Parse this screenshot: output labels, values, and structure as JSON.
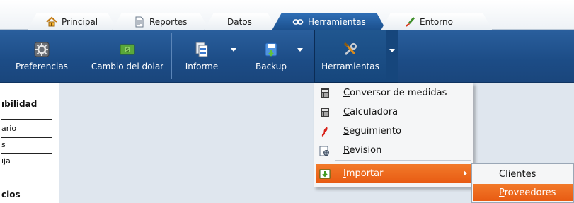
{
  "tabs": [
    {
      "label": "Principal",
      "icon": "home-icon",
      "active": false
    },
    {
      "label": "Reportes",
      "icon": "document-icon",
      "active": false
    },
    {
      "label": "Datos",
      "icon": "",
      "active": false
    },
    {
      "label": "Herramientas",
      "icon": "link-icon",
      "active": true
    },
    {
      "label": "Entorno",
      "icon": "brush-icon",
      "active": false
    }
  ],
  "ribbon": {
    "preferencias": "Preferencias",
    "cambio_dolar": "Cambio del dolar",
    "informe": "Informe",
    "backup": "Backup",
    "herramientas": "Herramientas"
  },
  "left_panel": {
    "heading1": "ıbilidad",
    "items": [
      "ario",
      "s",
      "ıja"
    ],
    "heading2": "cios"
  },
  "menu": {
    "items": [
      {
        "label": "Conversor de medidas",
        "mnemonic": "C",
        "rest": "onversor de medidas",
        "icon": "calculator-icon"
      },
      {
        "label": "Calculadora",
        "mnemonic": "C",
        "rest": "alculadora",
        "icon": "calculator-icon"
      },
      {
        "label": "Seguimiento",
        "mnemonic": "S",
        "rest": "eguimiento",
        "icon": "tracking-icon"
      },
      {
        "label": "Revision",
        "mnemonic": "R",
        "rest": "evision",
        "icon": "review-icon"
      }
    ],
    "importar": {
      "label": "Importar",
      "mnemonic": "I",
      "rest": "mportar",
      "icon": "import-icon"
    }
  },
  "submenu": {
    "items": [
      {
        "label": "Clientes",
        "mnemonic": "C",
        "rest": "lientes",
        "highlighted": false
      },
      {
        "label": "Proveedores",
        "mnemonic": "P",
        "rest": "roveedores",
        "highlighted": true
      }
    ]
  },
  "colors": {
    "ribbon": "#1c4c86",
    "highlight": "#e85b13",
    "active_tab": "#2f6eb5"
  }
}
